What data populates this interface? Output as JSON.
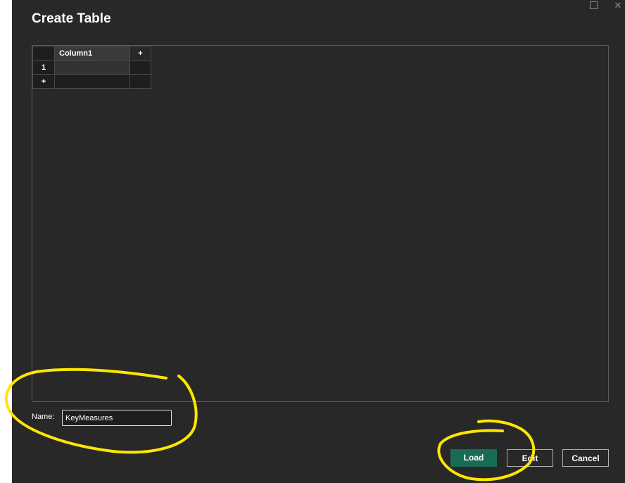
{
  "dialog": {
    "title": "Create Table"
  },
  "grid": {
    "columns": [
      "Column1"
    ],
    "add_column_label": "+",
    "rows": [
      {
        "number": "1",
        "cells": [
          ""
        ]
      }
    ],
    "add_row_label": "+"
  },
  "name_field": {
    "label": "Name:",
    "value": "KeyMeasures"
  },
  "buttons": {
    "load": "Load",
    "edit": "Edit",
    "cancel": "Cancel"
  },
  "colors": {
    "dialog_bg": "#282828",
    "primary_button": "#1a6b55",
    "annotation": "#ffe600"
  },
  "icons": [
    "maximize-icon",
    "close-icon"
  ]
}
